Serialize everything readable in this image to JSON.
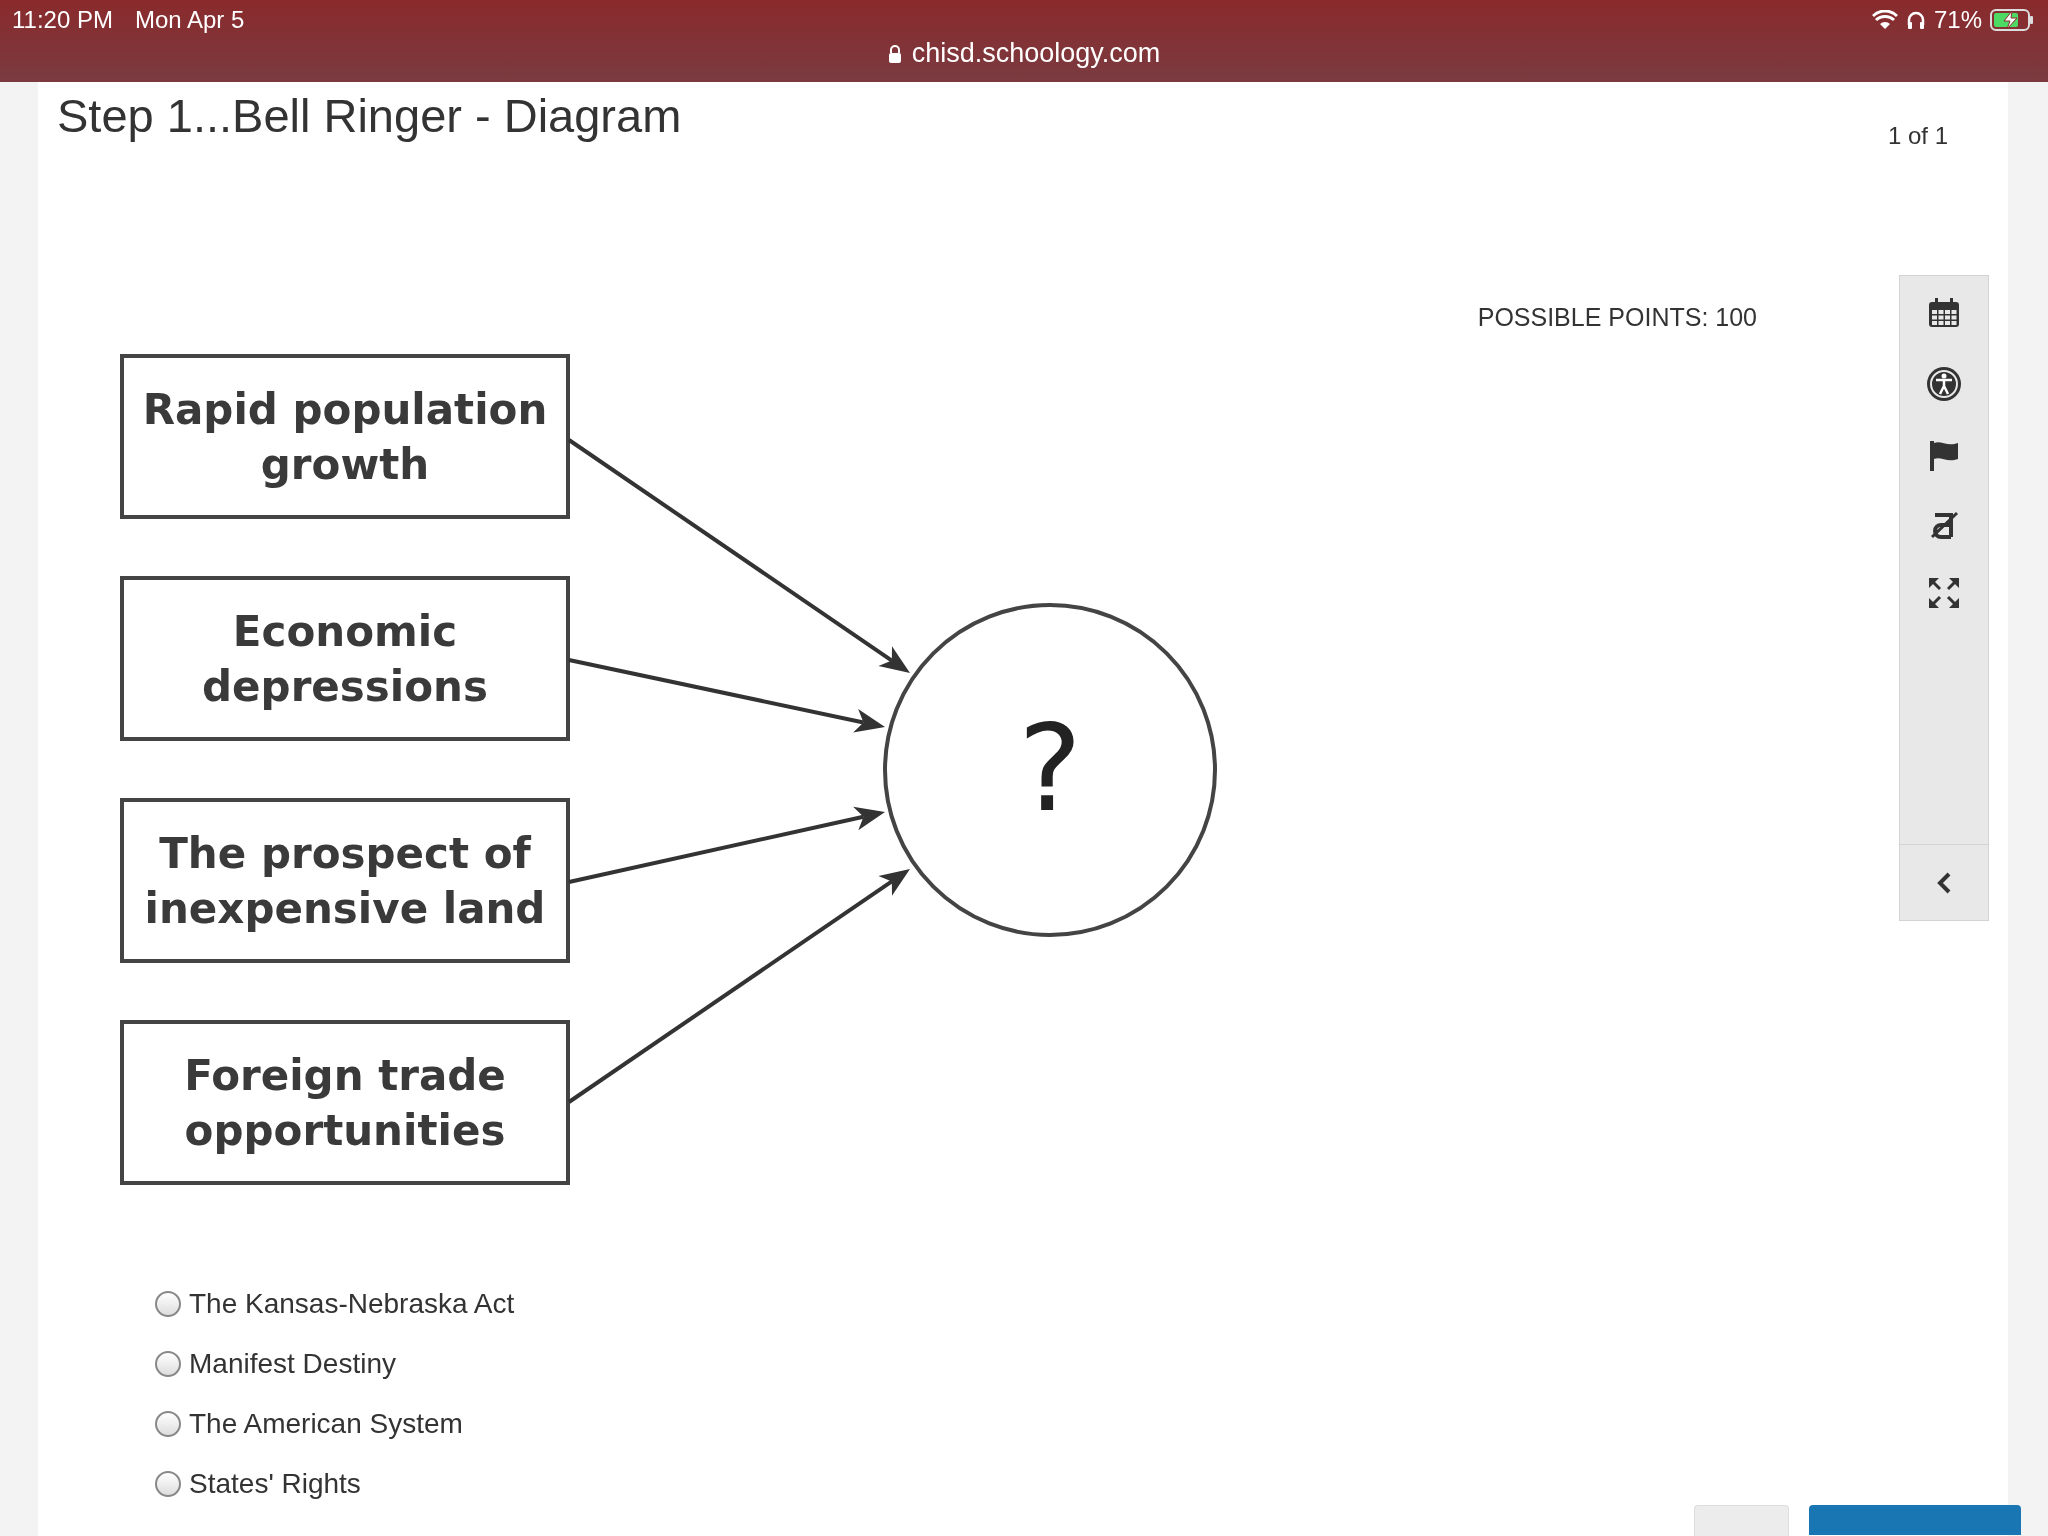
{
  "status_bar": {
    "time": "11:20 PM",
    "date": "Mon Apr 5",
    "url": "chisd.schoology.com",
    "battery": "71%"
  },
  "header": {
    "title": "Step 1...Bell Ringer - Diagram",
    "page_count": "1 of 1"
  },
  "question": {
    "points": "POSSIBLE POINTS: 100",
    "diagram": {
      "causes": [
        {
          "lines": [
            "Rapid population",
            "growth"
          ]
        },
        {
          "lines": [
            "Economic",
            "depressions"
          ]
        },
        {
          "lines": [
            "The prospect of",
            "inexpensive land"
          ]
        },
        {
          "lines": [
            "Foreign trade",
            "opportunities"
          ]
        }
      ],
      "effect": "?"
    },
    "options": [
      {
        "label": "The Kansas-Nebraska Act",
        "selected": false
      },
      {
        "label": "Manifest Destiny",
        "selected": false
      },
      {
        "label": "The American System",
        "selected": false
      },
      {
        "label": "States' Rights",
        "selected": false
      }
    ]
  },
  "toolbar": {
    "tools": [
      {
        "kind": "calendar"
      },
      {
        "kind": "accessibility"
      },
      {
        "kind": "flag"
      },
      {
        "kind": "strike"
      },
      {
        "kind": "expand"
      }
    ],
    "collapse": {
      "kind": "chevron"
    }
  }
}
